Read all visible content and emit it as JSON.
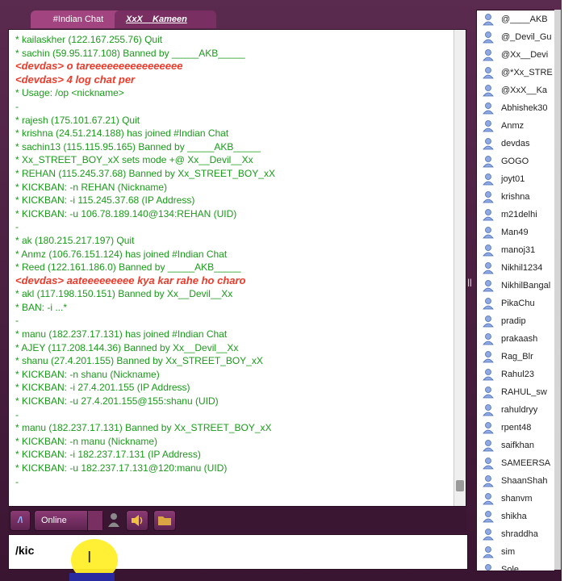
{
  "tabs": [
    {
      "label": "#Indian Chat",
      "active": true
    },
    {
      "label": "XxX__Kameen",
      "active": false
    }
  ],
  "chat_lines": [
    {
      "text": "* kailaskher (122.167.255.76) Quit",
      "style": "green"
    },
    {
      "text": "* sachin (59.95.117.108) Banned by _____AKB_____",
      "style": "green"
    },
    {
      "text": "<devdas> o tareeeeeeeeeeeeeeee",
      "style": "red"
    },
    {
      "text": "<devdas> 4 log chat per",
      "style": "red"
    },
    {
      "text": "* Usage: /op <nickname>",
      "style": "green"
    },
    {
      "text": "-",
      "style": "green"
    },
    {
      "text": "* rajesh (175.101.67.21) Quit",
      "style": "green"
    },
    {
      "text": "* krishna (24.51.214.188) has joined #Indian Chat",
      "style": "green"
    },
    {
      "text": "* sachin13 (115.115.95.165) Banned by _____AKB_____",
      "style": "green"
    },
    {
      "text": "* Xx_STREET_BOY_xX sets mode +@ Xx__Devil__Xx",
      "style": "green"
    },
    {
      "text": "* REHAN (115.245.37.68) Banned by Xx_STREET_BOY_xX",
      "style": "green"
    },
    {
      "text": "* KICKBAN: -n REHAN (Nickname)",
      "style": "green"
    },
    {
      "text": "* KICKBAN: -i 115.245.37.68 (IP Address)",
      "style": "green"
    },
    {
      "text": "* KICKBAN: -u 106.78.189.140@134:REHAN (UID)",
      "style": "green"
    },
    {
      "text": "-",
      "style": "green"
    },
    {
      "text": "* ak (180.215.217.197) Quit",
      "style": "green"
    },
    {
      "text": "* Anmz (106.76.151.124) has joined #Indian Chat",
      "style": "green"
    },
    {
      "text": "* Reed (122.161.186.0) Banned by _____AKB_____",
      "style": "green"
    },
    {
      "text": "<devdas> aateeeeeeeee kya kar rahe ho charo",
      "style": "red"
    },
    {
      "text": "* akl (117.198.150.151) Banned by Xx__Devil__Xx",
      "style": "green"
    },
    {
      "text": "* BAN: -i ...*",
      "style": "green"
    },
    {
      "text": "-",
      "style": "green"
    },
    {
      "text": "* manu (182.237.17.131) has joined #Indian Chat",
      "style": "green"
    },
    {
      "text": "* AJEY (117.208.144.36) Banned by Xx__Devil__Xx",
      "style": "green"
    },
    {
      "text": "* shanu (27.4.201.155) Banned by Xx_STREET_BOY_xX",
      "style": "green"
    },
    {
      "text": "* KICKBAN: -n shanu (Nickname)",
      "style": "green"
    },
    {
      "text": "* KICKBAN: -i 27.4.201.155 (IP Address)",
      "style": "green"
    },
    {
      "text": "* KICKBAN: -u 27.4.201.155@155:shanu (UID)",
      "style": "green"
    },
    {
      "text": "-",
      "style": "green"
    },
    {
      "text": "* manu (182.237.17.131) Banned by Xx_STREET_BOY_xX",
      "style": "green"
    },
    {
      "text": "* KICKBAN: -n manu (Nickname)",
      "style": "green"
    },
    {
      "text": "* KICKBAN: -i 182.237.17.131 (IP Address)",
      "style": "green"
    },
    {
      "text": "* KICKBAN: -u 182.237.17.131@120:manu (UID)",
      "style": "green"
    },
    {
      "text": "-",
      "style": "green"
    }
  ],
  "toolbar": {
    "logo_glyph": "/\\",
    "status_label": "Online",
    "user_icon": "user-silhouette-icon",
    "sound_icon": "speaker-icon",
    "folder_icon": "folder-icon"
  },
  "input": {
    "value": "/kic"
  },
  "users": [
    "@____AKB",
    "@_Devil_Gu",
    "@Xx__Devi",
    "@*Xx_STRE",
    "@XxX__Ka",
    "Abhishek30",
    "Anmz",
    "devdas",
    "GOGO",
    "joyt01",
    "krishna",
    "m21delhi",
    "Man49",
    "manoj31",
    "Nikhil1234",
    "NikhilBangal",
    "PikaChu",
    "pradip",
    "prakaash",
    "Rag_Blr",
    "Rahul23",
    "RAHUL_sw",
    "rahuldryy",
    "rpent48",
    "saifkhan",
    "SAMEERSA",
    "ShaanShah",
    "shanvm",
    "shikha",
    "shraddha",
    "sim",
    "Sole"
  ],
  "colors": {
    "frame": "#4a1f40",
    "tab_active": "#a2447f",
    "chat_text": "#1a9a1a",
    "chat_highlight": "#ee3a2a",
    "user_icon": "#6d8fd6"
  }
}
